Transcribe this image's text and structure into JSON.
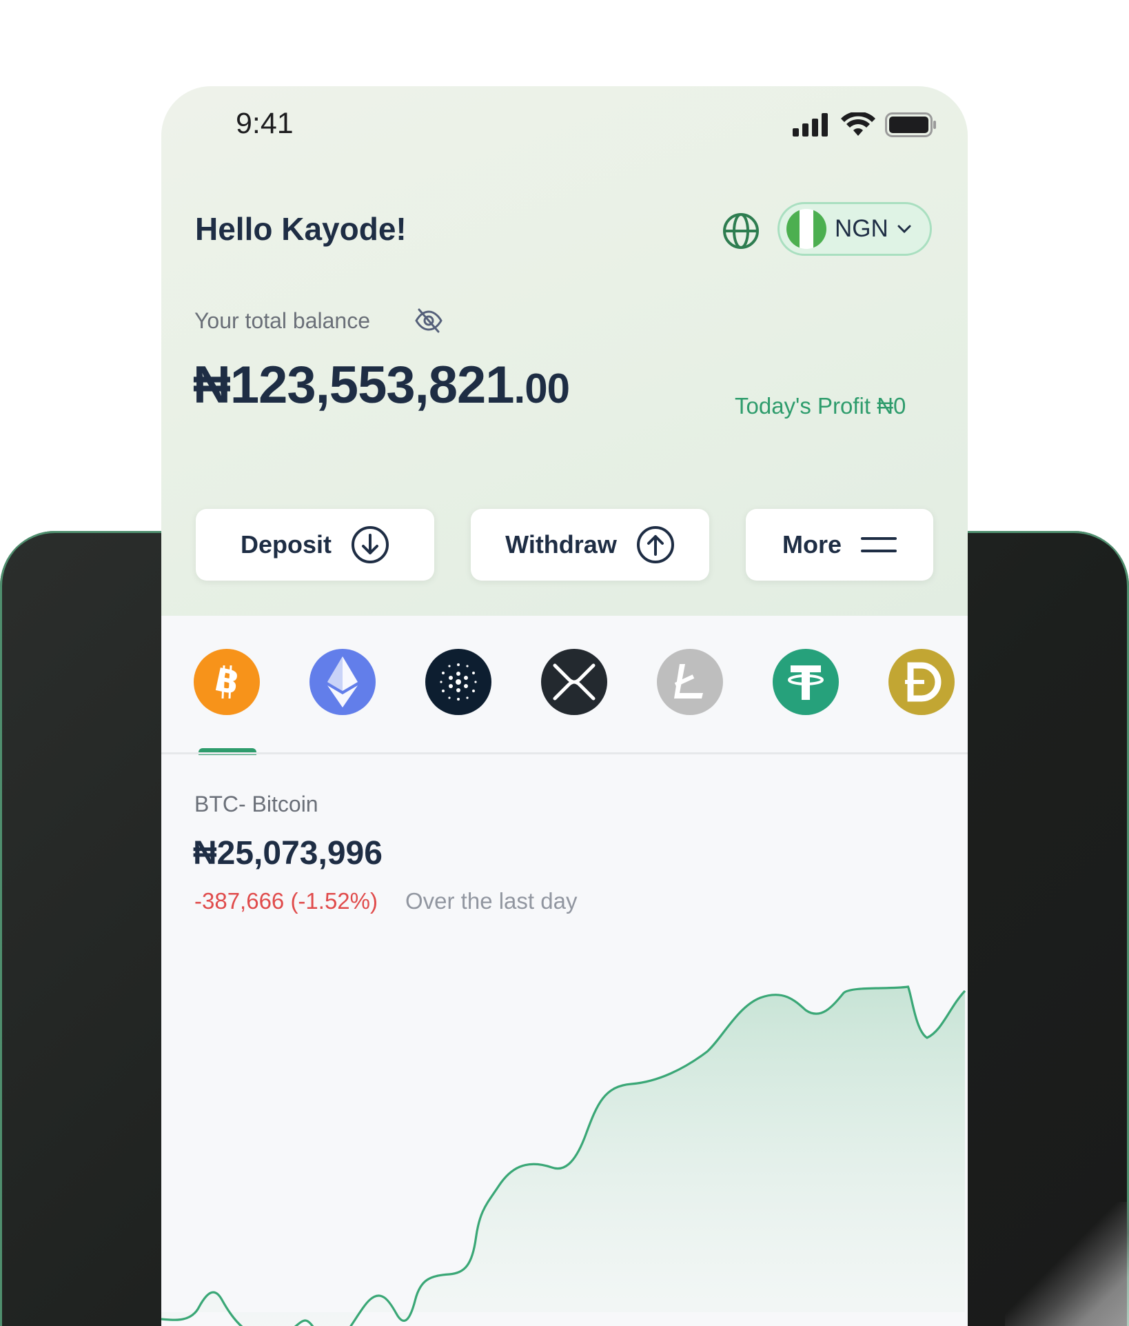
{
  "status_bar": {
    "time": "9:41"
  },
  "header": {
    "greeting": "Hello Kayode!",
    "currency": "NGN"
  },
  "balance": {
    "label": "Your total balance",
    "main": "₦123,553,821",
    "decimals": ".00",
    "profit": "Today's Profit ₦0"
  },
  "actions": {
    "deposit": "Deposit",
    "withdraw": "Withdraw",
    "more": "More"
  },
  "coins": [
    {
      "name": "bitcoin",
      "color": "#f7931a"
    },
    {
      "name": "ethereum",
      "color": "#627eea"
    },
    {
      "name": "cardano",
      "color": "#0d1e30"
    },
    {
      "name": "xrp",
      "color": "#23292f"
    },
    {
      "name": "litecoin",
      "color": "#bebebe"
    },
    {
      "name": "tether",
      "color": "#26a17b"
    },
    {
      "name": "dogecoin",
      "color": "#c2a633"
    }
  ],
  "asset": {
    "name": "BTC- Bitcoin",
    "price": "₦25,073,996",
    "change": "-387,666 (-1.52%)",
    "period": "Over the last day"
  },
  "colors": {
    "accent": "#2e9c6c",
    "negative": "#e04b4b",
    "text": "#1e2d44"
  }
}
